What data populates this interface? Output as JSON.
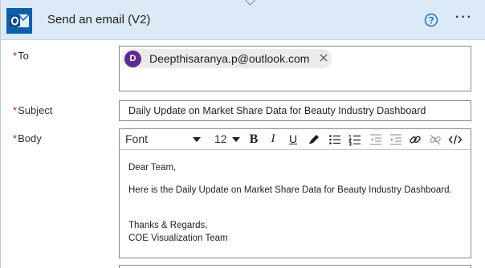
{
  "action": {
    "title": "Send an email (V2)",
    "app_icon": "outlook-icon",
    "help_icon": "help-circle-icon",
    "more_icon": "more-horizontal-icon",
    "more_glyph": "···"
  },
  "fields": {
    "required_marker": "*",
    "to": {
      "label": "To",
      "recipient": {
        "initial": "D",
        "email": "Deepthisaranya.p@outlook.com"
      }
    },
    "subject": {
      "label": "Subject",
      "value": "Daily Update on Market Share Data for Beauty Industry Dashboard"
    },
    "body": {
      "label": "Body",
      "toolbar": {
        "font": "Font",
        "size": "12",
        "bold": "B",
        "italic": "I",
        "underline": "U"
      },
      "content": {
        "greeting": "Dear Team,",
        "line1": "Here is the Daily Update on Market Share Data for Beauty Industry Dashboard.",
        "closing": "Thanks & Regards,",
        "signature": "COE Visualization Team"
      }
    }
  },
  "colors": {
    "header_bg": "#dce9f7",
    "accent": "#0f6cbd",
    "required": "#a4262c",
    "avatar": "#5c2d91"
  }
}
